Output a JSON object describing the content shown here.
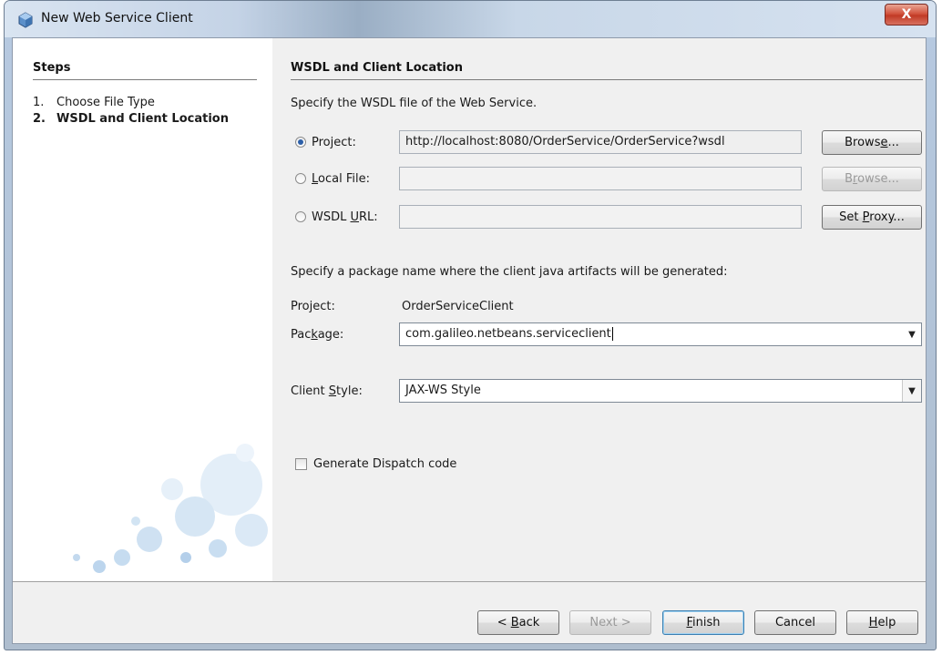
{
  "window": {
    "title": "New Web Service Client",
    "close_label": "X"
  },
  "steps": {
    "heading": "Steps",
    "items": [
      {
        "num": "1.",
        "label": "Choose File Type"
      },
      {
        "num": "2.",
        "label": "WSDL and Client Location"
      }
    ]
  },
  "main": {
    "heading": "WSDL and Client Location",
    "wsdl_intro": "Specify the WSDL file of the Web Service.",
    "sources": {
      "project": {
        "label_pre": "Project:",
        "value": "http://localhost:8080/OrderService/OrderService?wsdl",
        "checked": true
      },
      "local_file": {
        "label_u": "L",
        "label_rest": "ocal File:",
        "value": "",
        "checked": false
      },
      "wsdl_url": {
        "label_pre": "WSDL ",
        "label_u": "U",
        "label_rest": "RL:",
        "value": "",
        "checked": false
      }
    },
    "browse_project": {
      "pre": "Brows",
      "u": "e",
      "post": "..."
    },
    "browse_local": {
      "pre": "B",
      "u": "r",
      "post": "owse..."
    },
    "set_proxy": {
      "pre": "Set ",
      "u": "P",
      "post": "roxy..."
    },
    "package_intro": "Specify a package name where the client java artifacts will be generated:",
    "project_label": "Project:",
    "project_value": "OrderServiceClient",
    "package_label_pre": "Pac",
    "package_label_u": "k",
    "package_label_post": "age:",
    "package_value": "com.galileo.netbeans.serviceclient",
    "client_style_pre": "Client ",
    "client_style_u": "S",
    "client_style_post": "tyle:",
    "client_style_value": "JAX-WS Style",
    "dispatch_label": "Generate Dispatch code",
    "dispatch_checked": false
  },
  "footer": {
    "back": {
      "pre": "< ",
      "u": "B",
      "post": "ack"
    },
    "next": "Next >",
    "finish": {
      "u": "F",
      "post": "inish"
    },
    "cancel": "Cancel",
    "help": {
      "u": "H",
      "post": "elp"
    }
  },
  "icons": {
    "window": "netbeans-cube-icon",
    "close": "close-icon",
    "dropdown": "chevron-down-icon"
  }
}
